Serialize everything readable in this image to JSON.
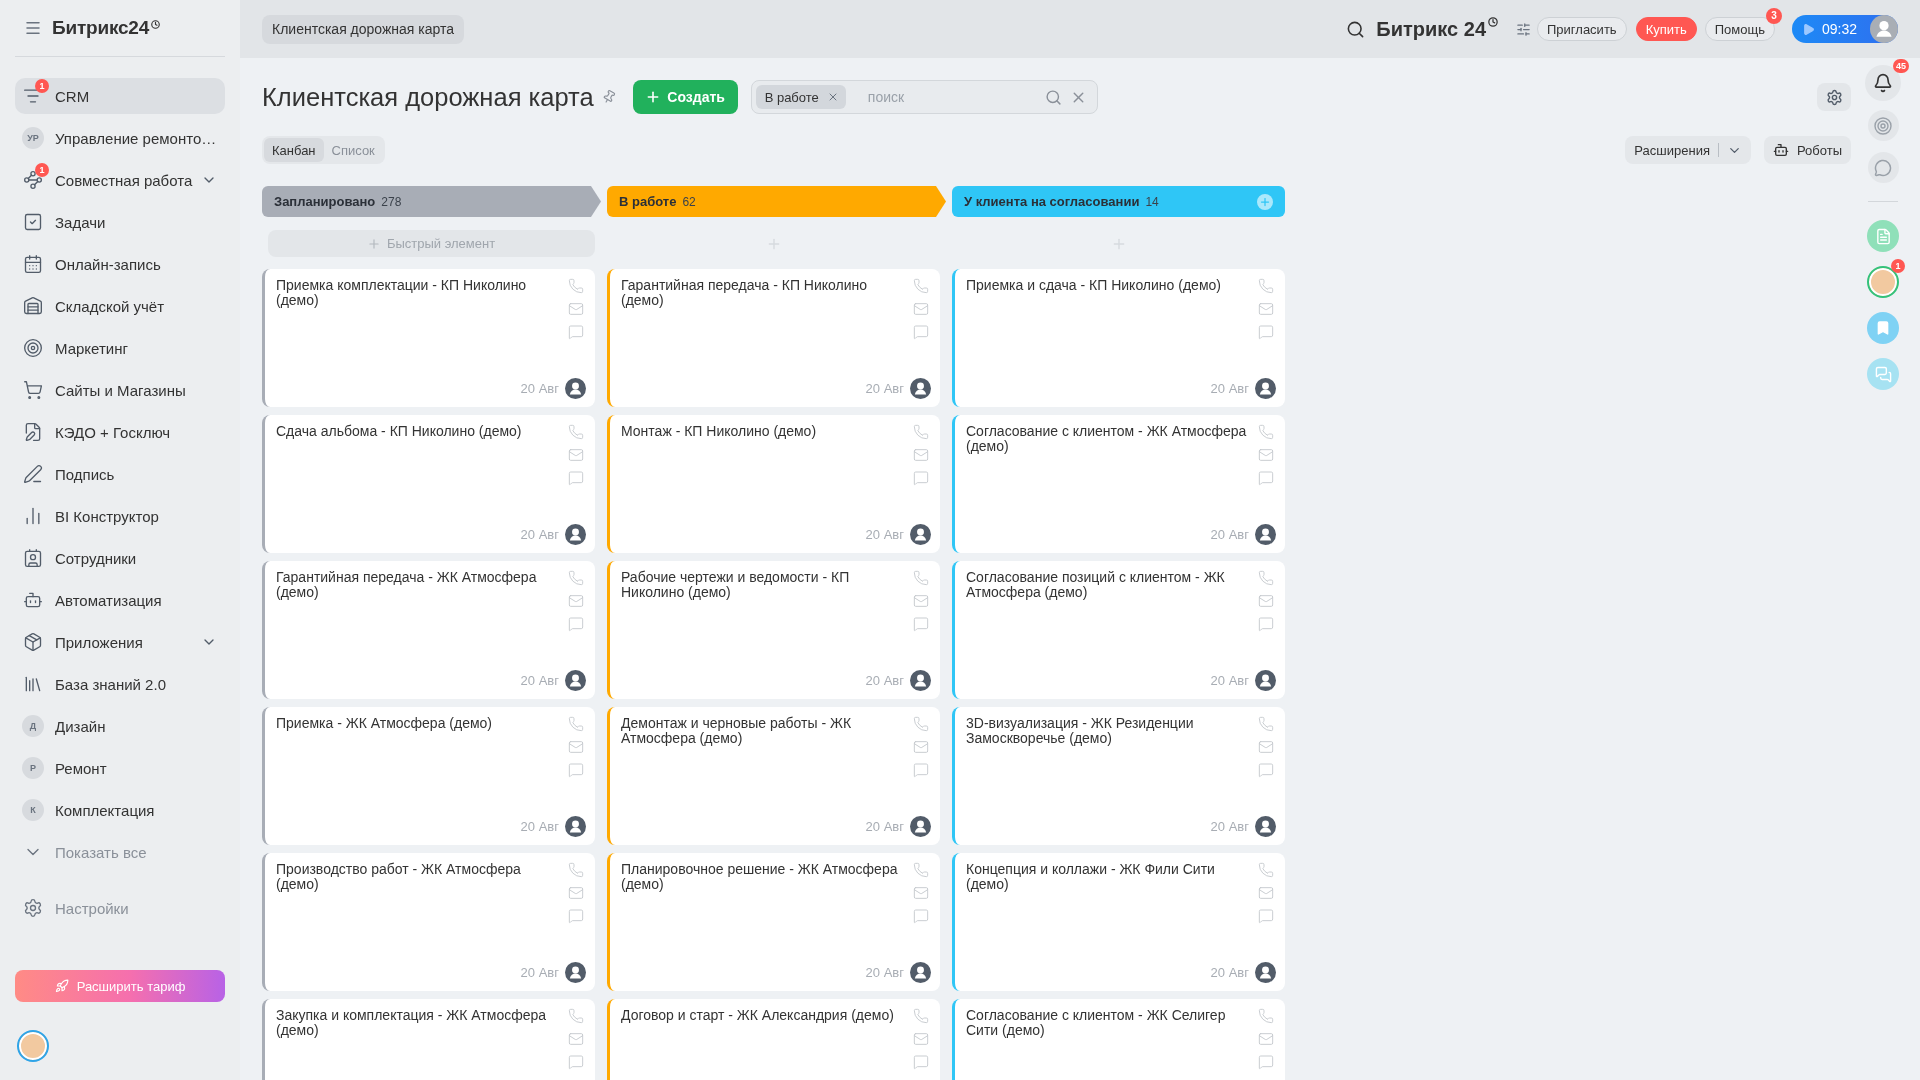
{
  "sidebar": {
    "logo": "Битрикс24",
    "items": [
      {
        "kind": "icon",
        "label": "CRM",
        "badge": "1",
        "selected": true,
        "submenu": false
      },
      {
        "kind": "avatar",
        "avatar": "УР",
        "label": "Управление ремонто…",
        "selected": false,
        "submenu": false
      },
      {
        "kind": "icon",
        "label": "Совместная работа",
        "badge": "1",
        "selected": false,
        "submenu": true
      },
      {
        "kind": "icon",
        "label": "Задачи",
        "selected": false,
        "submenu": false
      },
      {
        "kind": "icon",
        "label": "Онлайн-запись",
        "selected": false,
        "submenu": false
      },
      {
        "kind": "icon",
        "label": "Складской учёт",
        "selected": false,
        "submenu": false
      },
      {
        "kind": "icon",
        "label": "Маркетинг",
        "selected": false,
        "submenu": false
      },
      {
        "kind": "icon",
        "label": "Сайты и Магазины",
        "selected": false,
        "submenu": false
      },
      {
        "kind": "icon",
        "label": "КЭДО + Госключ",
        "selected": false,
        "submenu": false
      },
      {
        "kind": "icon",
        "label": "Подпись",
        "selected": false,
        "submenu": false
      },
      {
        "kind": "icon",
        "label": "BI Конструктор",
        "selected": false,
        "submenu": false
      },
      {
        "kind": "icon",
        "label": "Сотрудники",
        "selected": false,
        "submenu": false
      },
      {
        "kind": "icon",
        "label": "Автоматизация",
        "selected": false,
        "submenu": false
      },
      {
        "kind": "icon",
        "label": "Приложения",
        "selected": false,
        "submenu": true
      },
      {
        "kind": "icon",
        "label": "База знаний 2.0",
        "selected": false,
        "submenu": false
      },
      {
        "kind": "avatar",
        "avatar": "Д",
        "label": "Дизайн",
        "selected": false,
        "submenu": false
      },
      {
        "kind": "avatar",
        "avatar": "Р",
        "label": "Ремонт",
        "selected": false,
        "submenu": false
      },
      {
        "kind": "avatar",
        "avatar": "К",
        "label": "Комплектация",
        "selected": false,
        "submenu": false
      }
    ],
    "show_all": "Показать все",
    "settings": "Настройки",
    "upgrade_button": "Расширить тариф"
  },
  "top_bar": {
    "breadcrumb": "Клиентская дорожная карта",
    "logo": "Битрикс 24",
    "invite_button": "Пригласить",
    "buy_button": "Купить",
    "help_button": "Помощь",
    "help_badge": "3",
    "time": "09:32"
  },
  "page": {
    "title": "Клиентская дорожная карта",
    "create_button": "Создать",
    "filter": {
      "chip": "В работе",
      "placeholder": "поиск"
    },
    "view_tabs": [
      {
        "label": "Канбан",
        "selected": true
      },
      {
        "label": "Список",
        "selected": false
      }
    ],
    "extensions_button": "Расширения",
    "robots_button": "Роботы"
  },
  "right_rail": {
    "notifications_badge": "45",
    "avatar_badge": "1"
  },
  "columns": [
    {
      "title": "Запланировано",
      "count": "278",
      "color": "#a8adb6",
      "quick_add": "Быстрый элемент",
      "cards": [
        {
          "title": "Приемка комплектации - КП Николино (демо)",
          "date": "20 Авг"
        },
        {
          "title": "Сдача альбома - КП Николино (демо)",
          "date": "20 Авг"
        },
        {
          "title": "Гарантийная передача - ЖК Атмосфера (демо)",
          "date": "20 Авг"
        },
        {
          "title": "Приемка - ЖК Атмосфера (демо)",
          "date": "20 Авг"
        },
        {
          "title": "Производство работ - ЖК Атмосфера (демо)",
          "date": "20 Авг"
        },
        {
          "title": "Закупка и комплектация - ЖК Атмосфера (демо)"
        }
      ]
    },
    {
      "title": "В работе",
      "count": "62",
      "color": "#ffa900",
      "cards": [
        {
          "title": "Гарантийная передача - КП Николино (демо)",
          "date": "20 Авг"
        },
        {
          "title": "Монтаж - КП Николино (демо)",
          "date": "20 Авг"
        },
        {
          "title": "Рабочие чертежи и ведомости - КП Николино (демо)",
          "date": "20 Авг"
        },
        {
          "title": "Демонтаж и черновые работы - ЖК Атмосфера (демо)",
          "date": "20 Авг"
        },
        {
          "title": "Планировочное решение - ЖК Атмосфера (демо)",
          "date": "20 Авг"
        },
        {
          "title": "Договор и старт - ЖК Александрия (демо)"
        }
      ]
    },
    {
      "title": "У клиента на согласовании",
      "count": "14",
      "color": "#2fc6f6",
      "cards": [
        {
          "title": "Приемка и сдача - КП Николино (демо)",
          "date": "20 Авг"
        },
        {
          "title": "Согласование с клиентом - ЖК Атмосфера (демо)",
          "date": "20 Авг"
        },
        {
          "title": "Согласование позиций с клиентом - ЖК Атмосфера (демо)",
          "date": "20 Авг"
        },
        {
          "title": "3D-визуализация - ЖК Резиденции Замоскворечье (демо)",
          "date": "20 Авг"
        },
        {
          "title": "Концепция и коллажи - ЖК Фили Сити (демо)",
          "date": "20 Авг"
        },
        {
          "title": "Согласование с клиентом - ЖК Селигер Сити (демо)"
        }
      ]
    }
  ]
}
